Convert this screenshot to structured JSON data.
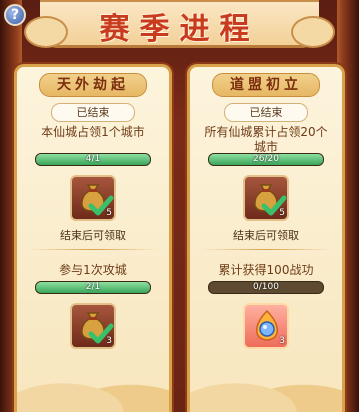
{
  "title": "赛季进程",
  "help_label": "?",
  "panels": [
    {
      "title": "天外劫起",
      "status": "已结束",
      "tasks": [
        {
          "text": "本仙城占领1个城市",
          "progress_text": "4/1",
          "progress_fraction": 1.0,
          "reward_count": "5",
          "reward_icon": "sack-icon",
          "claimed": true,
          "hint": "结束后可领取"
        },
        {
          "text": "参与1次攻城",
          "progress_text": "2/1",
          "progress_fraction": 1.0,
          "reward_count": "3",
          "reward_icon": "sack-icon",
          "claimed": true,
          "hint": ""
        }
      ]
    },
    {
      "title": "道盟初立",
      "status": "已结束",
      "tasks": [
        {
          "text": "所有仙城累计占领20个城市",
          "progress_text": "26/20",
          "progress_fraction": 1.0,
          "reward_count": "5",
          "reward_icon": "sack-icon",
          "claimed": true,
          "hint": "结束后可领取"
        },
        {
          "text": "累计获得100战功",
          "progress_text": "0/100",
          "progress_fraction": 0.0,
          "reward_count": "3",
          "reward_icon": "flame-orb-icon",
          "claimed": false,
          "hint": ""
        }
      ]
    }
  ],
  "colors": {
    "title_red": "#c83b1e",
    "progress_green": "#3aa65a",
    "panel_cream": "#fdf4dd"
  }
}
